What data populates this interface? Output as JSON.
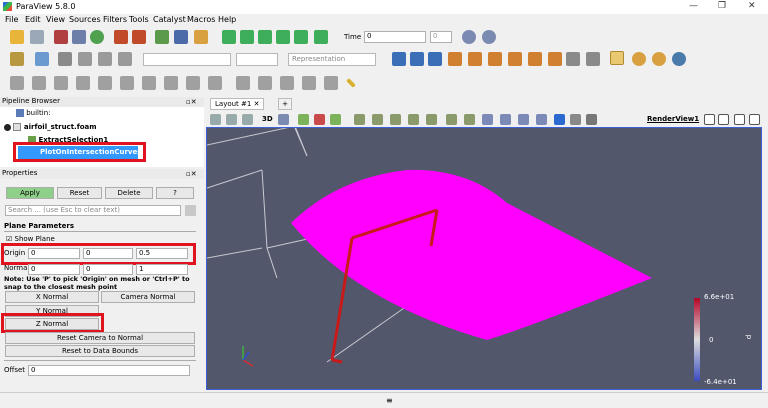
{
  "window": {
    "title": "ParaView 5.8.0"
  },
  "menu": [
    "File",
    "Edit",
    "View",
    "Sources",
    "Filters",
    "Tools",
    "Catalyst",
    "Macros",
    "Help"
  ],
  "toolbar": {
    "time_label": "Time",
    "time_value": "0",
    "time_step": "0",
    "representation_placeholder": "Representation"
  },
  "pipeline": {
    "title": "Pipeline Browser",
    "items": [
      "builtin:",
      "airfoil_struct.foam",
      "ExtractSelection1",
      "PlotOnIntersectionCurves1"
    ]
  },
  "layout": {
    "tab_label": "Layout #1",
    "view_name": "RenderView1",
    "view_3d": "3D"
  },
  "properties": {
    "title": "Properties",
    "apply": "Apply",
    "reset": "Reset",
    "delete": "Delete",
    "help": "?",
    "search_placeholder": "Search ... (use Esc to clear text)",
    "section": "Plane Parameters",
    "show_plane": "Show Plane",
    "origin_label": "Origin",
    "origin": [
      "0",
      "0",
      "0.5"
    ],
    "normal_label": "Normal",
    "normal": [
      "0",
      "0",
      "1"
    ],
    "note": "Note: Use 'P' to pick 'Origin' on mesh or 'Ctrl+P' to snap to the closest mesh point",
    "x_normal": "X Normal",
    "y_normal": "Y Normal",
    "z_normal": "Z Normal",
    "camera_normal": "Camera Normal",
    "reset_camera_normal": "Reset Camera to Normal",
    "reset_bounds": "Reset to Data Bounds",
    "offset_label": "Offset",
    "offset_value": "0"
  },
  "colorbar": {
    "max": "6.6e+01",
    "mid": "0",
    "min": "-6.4e+01",
    "title": "p"
  }
}
